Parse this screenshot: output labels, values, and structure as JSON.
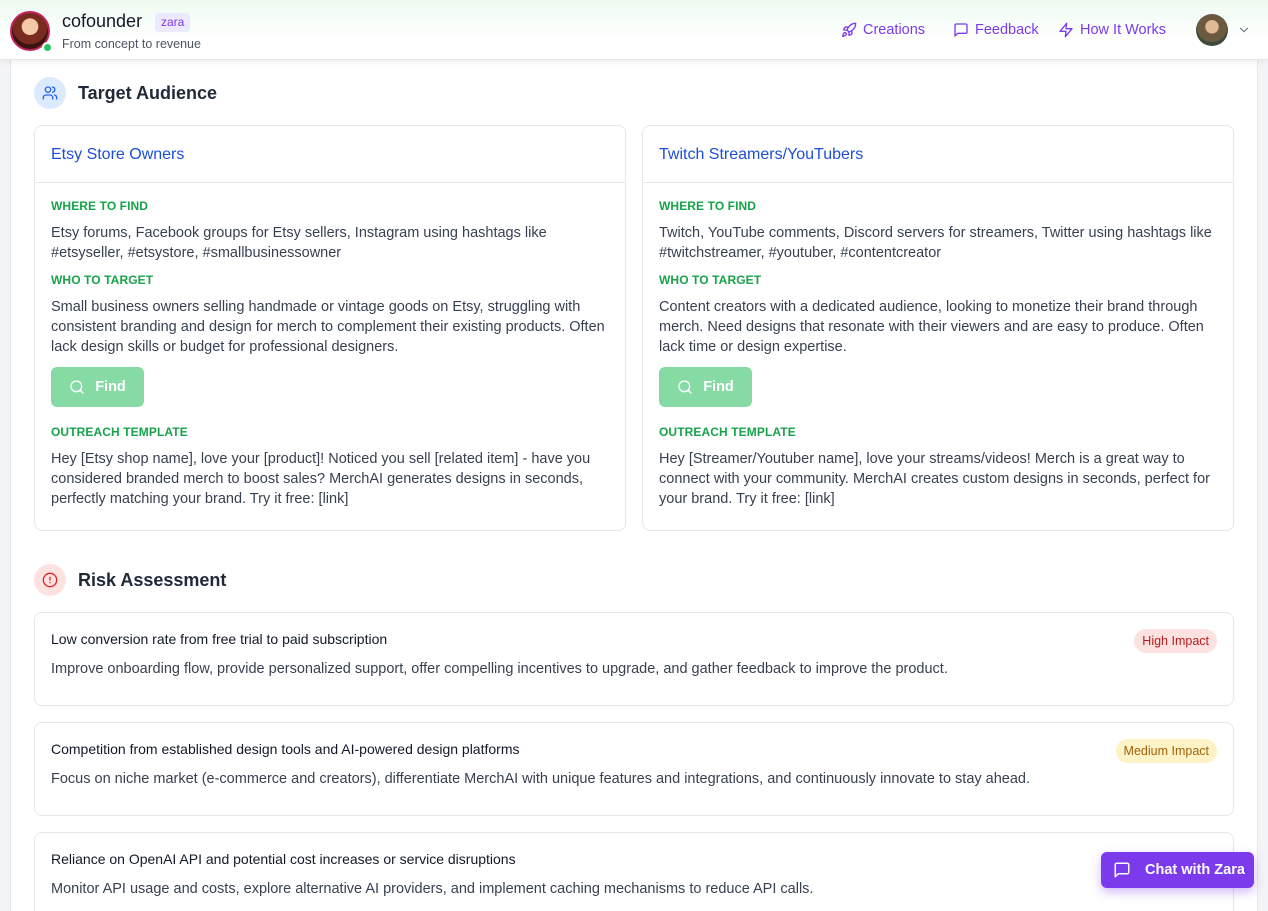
{
  "header": {
    "brand_name": "cofounder",
    "brand_badge": "zara",
    "tagline": "From concept to revenue",
    "nav": [
      {
        "label": "Creations",
        "icon": "rocket-icon"
      },
      {
        "label": "Feedback",
        "icon": "message-square-icon"
      },
      {
        "label": "How It Works",
        "icon": "lightning-icon"
      }
    ]
  },
  "target_audience": {
    "title": "Target Audience",
    "icon": "users-icon",
    "cards": [
      {
        "title": "Etsy Store Owners",
        "where_label": "WHERE TO FIND",
        "where_text": "Etsy forums, Facebook groups for Etsy sellers, Instagram using hashtags like #etsyseller, #etsystore, #smallbusinessowner",
        "who_label": "WHO TO TARGET",
        "who_text": "Small business owners selling handmade or vintage goods on Etsy, struggling with consistent branding and design for merch to complement their existing products. Often lack design skills or budget for professional designers.",
        "find_label": "Find",
        "outreach_label": "OUTREACH TEMPLATE",
        "outreach_text": "Hey [Etsy shop name], love your [product]! Noticed you sell [related item] - have you considered branded merch to boost sales? MerchAI generates designs in seconds, perfectly matching your brand. Try it free: [link]"
      },
      {
        "title": "Twitch Streamers/YouTubers",
        "where_label": "WHERE TO FIND",
        "where_text": "Twitch, YouTube comments, Discord servers for streamers, Twitter using hashtags like #twitchstreamer, #youtuber, #contentcreator",
        "who_label": "WHO TO TARGET",
        "who_text": "Content creators with a dedicated audience, looking to monetize their brand through merch. Need designs that resonate with their viewers and are easy to produce. Often lack time or design expertise.",
        "find_label": "Find",
        "outreach_label": "OUTREACH TEMPLATE",
        "outreach_text": "Hey [Streamer/Youtuber name], love your streams/videos! Merch is a great way to connect with your community. MerchAI creates custom designs in seconds, perfect for your brand. Try it free: [link]"
      }
    ]
  },
  "risk_assessment": {
    "title": "Risk Assessment",
    "icon": "alert-circle-icon",
    "risks": [
      {
        "title": "Low conversion rate from free trial to paid subscription",
        "impact": "High Impact",
        "impact_bg": "#fee2e2",
        "impact_color": "#b91c1c",
        "mitigation": "Improve onboarding flow, provide personalized support, offer compelling incentives to upgrade, and gather feedback to improve the product."
      },
      {
        "title": "Competition from established design tools and AI-powered design platforms",
        "impact": "Medium Impact",
        "impact_bg": "#fef3c7",
        "impact_color": "#a16207",
        "mitigation": "Focus on niche market (e-commerce and creators), differentiate MerchAI with unique features and integrations, and continuously innovate to stay ahead."
      },
      {
        "title": "Reliance on OpenAI API and potential cost increases or service disruptions",
        "impact": "",
        "impact_bg": "#fef3c7",
        "impact_color": "#a16207",
        "mitigation": "Monitor API usage and costs, explore alternative AI providers, and implement caching mechanisms to reduce API calls."
      }
    ]
  },
  "chat": {
    "label": "Chat with Zara",
    "icon": "chat-icon"
  },
  "colors": {
    "accent": "#7c3aed",
    "section_label": "#16a34a",
    "card_title": "#1d4ed8",
    "find_button": "#86dba5"
  }
}
